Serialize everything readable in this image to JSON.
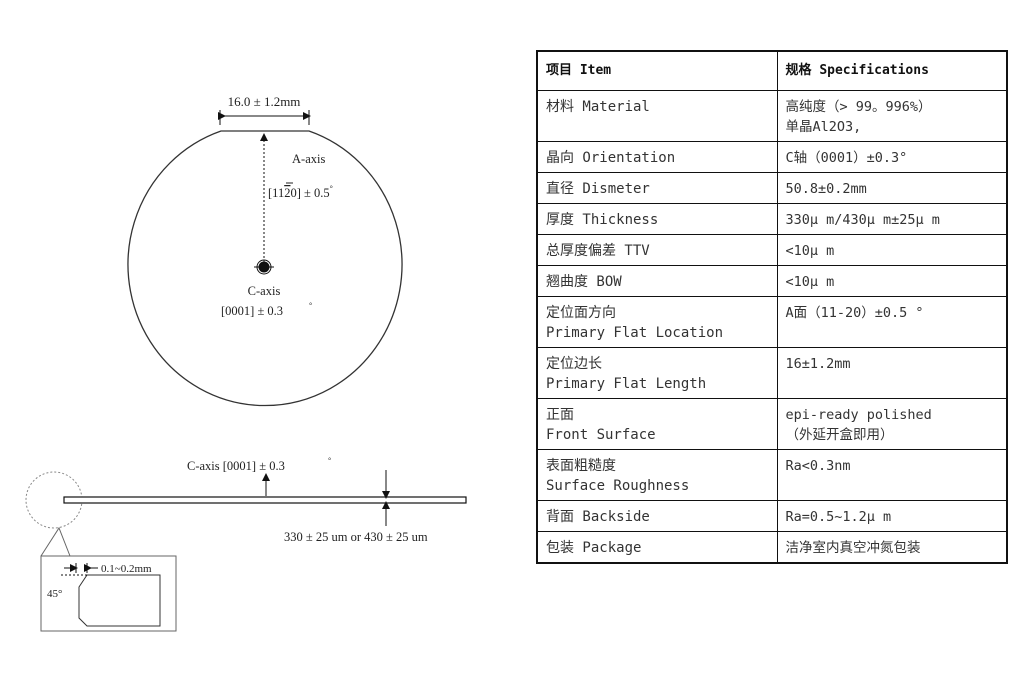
{
  "diagram": {
    "top_view": {
      "flat_length_label": "16.0 ± 1.2mm",
      "a_axis_label": "A-axis",
      "a_axis_index": "[1120] ± 0.5°",
      "a_axis_index_parts": {
        "open": "[11",
        "bar": "2",
        "close": "0]",
        "tol": "± 0.5",
        "deg": "°"
      },
      "c_axis_label": "C-axis",
      "c_axis_index": "[0001] ±  0.3",
      "c_axis_deg": "°"
    },
    "side_view": {
      "c_axis_label": "C-axis [0001] ±  0.3",
      "c_axis_deg": "°",
      "thickness_label": "330 ± 25 um  or  430 ± 25 um",
      "bevel_width_label": "0.1~0.2mm",
      "bevel_angle_label": "45°"
    }
  },
  "table": {
    "headers": [
      "项目 Item",
      "规格 Specifications"
    ],
    "rows": [
      {
        "item": "材料 Material",
        "spec": "高纯度（> 99。996%）\n单晶Al2O3,"
      },
      {
        "item": "晶向 Orientation",
        "spec": "C轴（0001）±0.3°"
      },
      {
        "item": "直径 Dismeter",
        "spec": "50.8±0.2mm"
      },
      {
        "item": "厚度 Thickness",
        "spec": "330μ m/430μ m±25μ m"
      },
      {
        "item": "总厚度偏差 TTV",
        "spec": "<10μ m"
      },
      {
        "item": "翘曲度     BOW",
        "spec": "<10μ m"
      },
      {
        "item": "定位面方向\nPrimary Flat Location",
        "spec": "A面（11-20）±0.5 °"
      },
      {
        "item": "定位边长\nPrimary Flat Length",
        "spec": "16±1.2mm"
      },
      {
        "item": "正面\nFront Surface",
        "spec": "epi-ready polished\n（外延开盒即用）"
      },
      {
        "item": "表面粗糙度\nSurface Roughness",
        "spec": "Ra<0.3nm"
      },
      {
        "item": "背面    Backside",
        "spec": "Ra=0.5~1.2μ m"
      },
      {
        "item": "包装    Package",
        "spec": "洁净室内真空冲氮包装"
      }
    ]
  }
}
